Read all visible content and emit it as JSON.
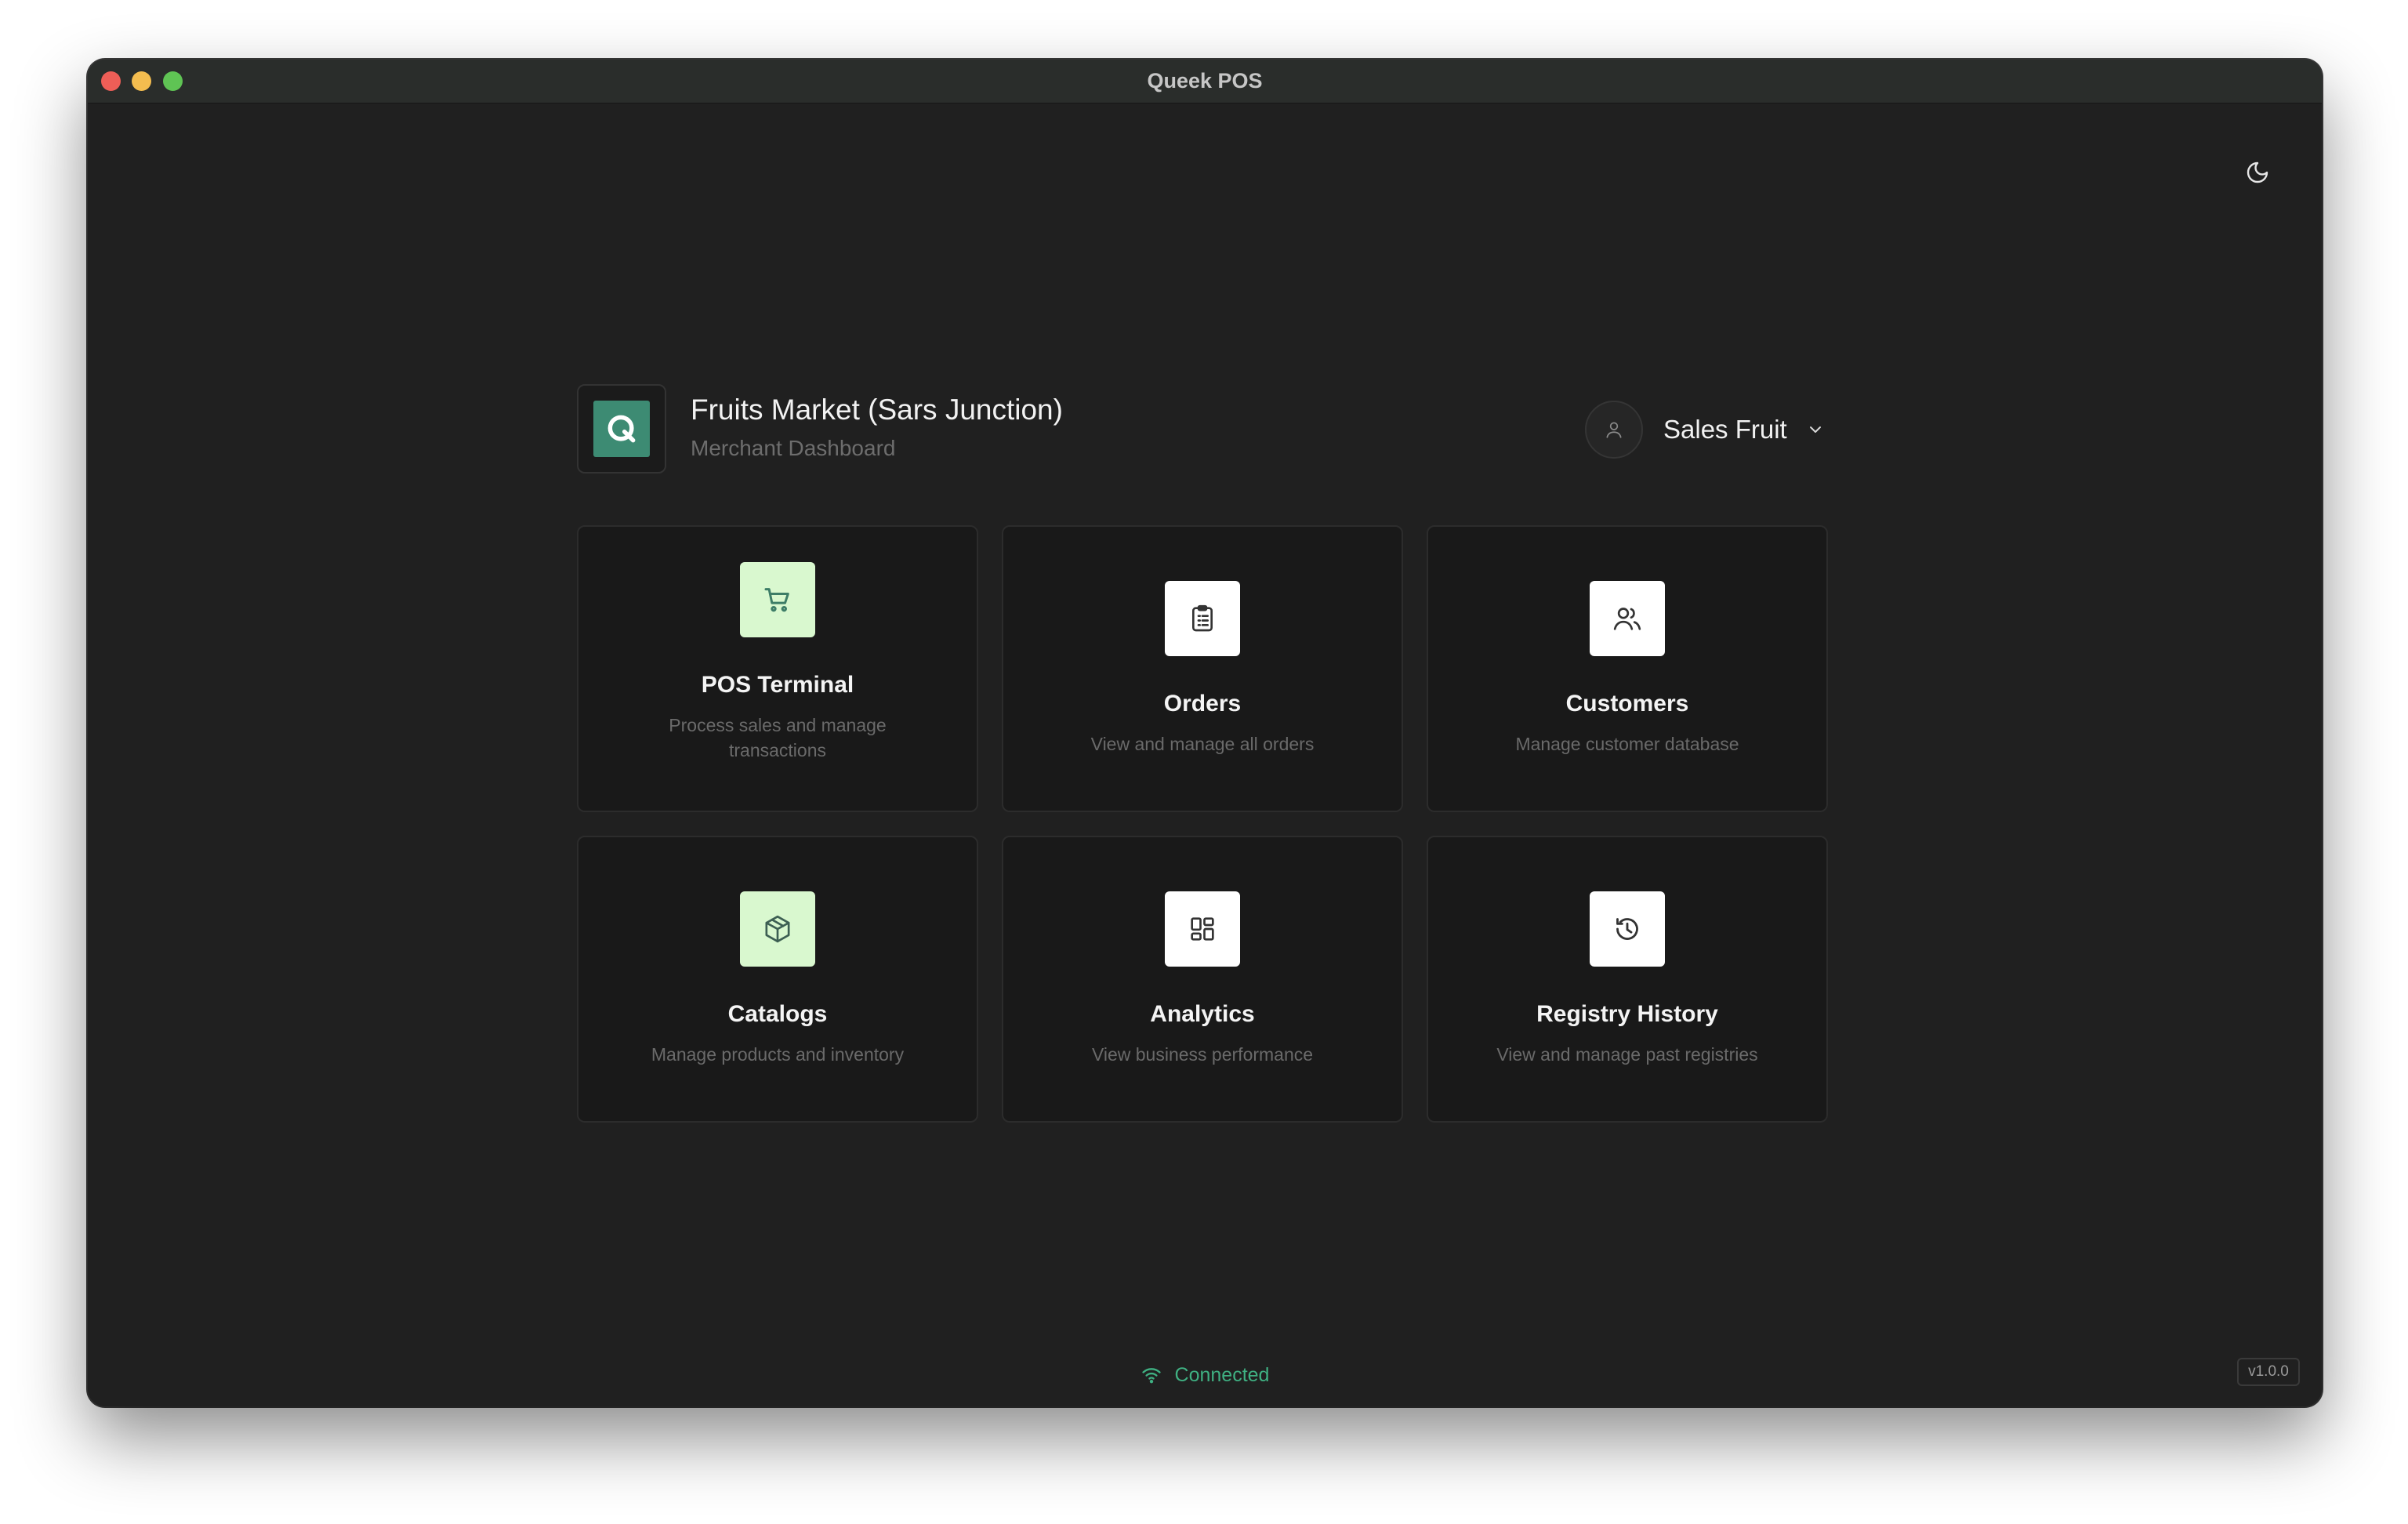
{
  "window": {
    "title": "Queek POS"
  },
  "merchant": {
    "name": "Fruits Market (Sars Junction)",
    "subtitle": "Merchant Dashboard"
  },
  "user": {
    "name": "Sales Fruit"
  },
  "cards": [
    {
      "title": "POS Terminal",
      "description": "Process sales and manage transactions",
      "icon": "shopping-cart-icon",
      "tile": "green"
    },
    {
      "title": "Orders",
      "description": "View and manage all orders",
      "icon": "clipboard-list-icon",
      "tile": "white"
    },
    {
      "title": "Customers",
      "description": "Manage customer database",
      "icon": "users-icon",
      "tile": "white"
    },
    {
      "title": "Catalogs",
      "description": "Manage products and inventory",
      "icon": "package-icon",
      "tile": "green"
    },
    {
      "title": "Analytics",
      "description": "View business performance",
      "icon": "dashboard-grid-icon",
      "tile": "white"
    },
    {
      "title": "Registry History",
      "description": "View and manage past registries",
      "icon": "history-icon",
      "tile": "white"
    }
  ],
  "status": {
    "text": "Connected",
    "color": "#3fb082"
  },
  "version": "v1.0.0",
  "colors": {
    "accent_green": "#3d8b73",
    "tile_green": "#d9f8cf",
    "background": "#202020"
  }
}
